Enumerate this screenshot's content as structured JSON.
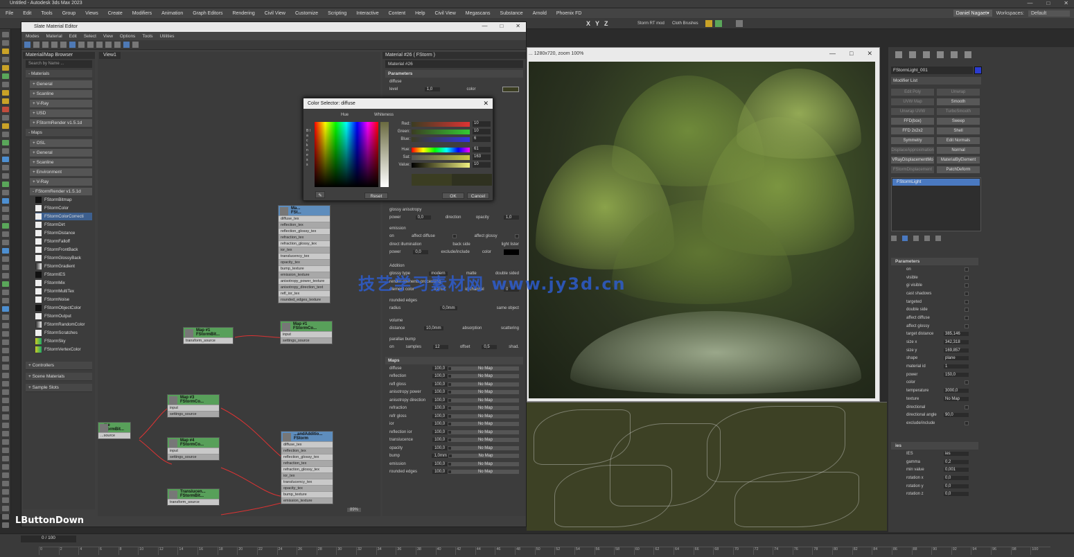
{
  "app": {
    "title": "Untitled - Autodesk 3ds Max 2023",
    "menu": [
      "File",
      "Edit",
      "Tools",
      "Group",
      "Views",
      "Create",
      "Modifiers",
      "Animation",
      "Graph Editors",
      "Rendering",
      "Civil View",
      "Customize",
      "Scripting",
      "Interactive",
      "Content",
      "Help",
      "Civil View",
      "Megascans",
      "Substance",
      "Arnold",
      "Phoenix FD"
    ],
    "user": "Daniel Nagaet▾",
    "workspaces_label": "Workspaces:",
    "workspace": "Default",
    "toolbar_labels": [
      "Storm RT mod",
      "Cloth Brushes"
    ],
    "axes": [
      "X",
      "Y",
      "Z"
    ]
  },
  "sme": {
    "title": "Slate Material Editor",
    "menu": [
      "Modes",
      "Material",
      "Edit",
      "Select",
      "View",
      "Options",
      "Tools",
      "Utilities"
    ],
    "browser": {
      "title": "Material/Map Browser",
      "search": "Search by Name ...",
      "materials_header": "- Materials",
      "materials": [
        "+ General",
        "+ Scanline",
        "+ V-Ray",
        "+ USD",
        "+ FStormRender v1.5.1d"
      ],
      "maps_header": "- Maps",
      "maps": [
        "+ OSL",
        "+ General",
        "+ Scanline",
        "+ Environment",
        "+ V-Ray"
      ],
      "fstorm_header": "- FStormRender v1.5.1d",
      "fstorm_items": [
        "FStormBitmap",
        "FStormColor",
        "FStormColorCorrecti",
        "FStormDirt",
        "FStormDistance",
        "FStormFalloff",
        "FStormFrontBack",
        "FStormGlossyBack",
        "FStormGradient",
        "FStormIES",
        "FStormMix",
        "FStormMultiTex",
        "FStormNoise",
        "FStormObjectColor",
        "FStormOutput",
        "FStormRandomColor",
        "FStormScratches",
        "FStormSky",
        "FStormVertexColor"
      ],
      "extra": [
        "+ Controllers",
        "+ Scene Materials",
        "+ Sample Slots"
      ]
    },
    "view": {
      "tab": "View1",
      "nodes": [
        {
          "title": "Ma...",
          "sub": "FSt...",
          "rows": [
            "diffuse_tex",
            "reflection_tex",
            "reflection_glossy_tex",
            "refraction_tex",
            "refraction_glossy_tex",
            "ior_tex",
            "translucency_tex",
            "opacity_tex",
            "bump_texture",
            "emission_texture",
            "anisotropy_power_texture",
            "anisotropy_direction_text",
            "refl_ior_tex",
            "rounded_edges_texture"
          ]
        },
        {
          "title": "Map #1",
          "sub": "FStormBit...",
          "rows": [
            "transform_source"
          ]
        },
        {
          "title": "Map #1",
          "sub": "FStormCo...",
          "rows": [
            "input",
            "settings_source"
          ]
        },
        {
          "title": "Map #3",
          "sub": "FStormCo...",
          "rows": [
            "input",
            "settings_source"
          ]
        },
        {
          "title": "Map #4",
          "sub": "FStormCo...",
          "rows": [
            "input",
            "settings_source"
          ]
        },
        {
          "title": "...me",
          "sub": "FStormBit...",
          "rows": [
            "...source"
          ]
        },
        {
          "title": "Translucen...",
          "sub": "FStormBit...",
          "rows": [
            "transform_source"
          ]
        },
        {
          "title": "...andAdditio...",
          "sub": "FStorm",
          "rows": [
            "diffuse_tex",
            "reflection_tex",
            "reflection_glossy_tex",
            "refraction_tex",
            "refraction_glossy_tex",
            "ior_tex",
            "translucency_tex",
            "opacity_tex",
            "bump_texture",
            "emission_texture"
          ]
        }
      ],
      "zoom": "89%"
    },
    "params": {
      "header": "Material #26  ( FStorm )",
      "name": "Material #26",
      "section_parameters": "Parameters",
      "diffuse_label": "diffuse",
      "level_label": "level",
      "level_value": "1,0",
      "color_label": "color",
      "glossy_aniso_label": "glossy anisotropy",
      "power_label": "power",
      "power_value": "0,0",
      "direction_label": "direction",
      "opacity_label": "opacity",
      "opacity_value": "1,0",
      "emission_label": "emission",
      "on_label": "on",
      "affect_diffuse": "affect diffuse",
      "affect_glossy": "affect glossy",
      "direct_illum": "direct illumination",
      "back_side": "back side",
      "light_lister": "light lister",
      "emission_power_value": "0,0",
      "exclude_include": "exclude/include",
      "addition_label": "Addition",
      "glossy_type_label": "glossy type",
      "glossy_type_value": "modern",
      "matte_label": "matte",
      "double_sided_label": "double sided",
      "rep_label": "render elements processing",
      "element_color_label": "element color",
      "transit_label": "transit",
      "id_channel_label": "id channel",
      "id_channel_value": "0",
      "rounded_edges_label": "rounded edges",
      "radius_label": "radius",
      "radius_value": "0,0mm",
      "same_object_label": "same object",
      "volume_label": "volume",
      "distance_label": "distance",
      "distance_value": "10,0mm",
      "absorption_label": "absorption",
      "scattering_label": "scattering",
      "parallax_label": "parallax bump",
      "samples_label": "samples",
      "samples_value": "12",
      "offset_label": "offset",
      "offset_value": "0,5",
      "shad_label": "shad.",
      "maps_header": "Maps",
      "maps": [
        {
          "name": "diffuse",
          "value": "100,0",
          "map": "No Map"
        },
        {
          "name": "reflection",
          "value": "100,0",
          "map": "No Map"
        },
        {
          "name": "refl gloss",
          "value": "100,0",
          "map": "No Map"
        },
        {
          "name": "anisotropy power",
          "value": "100,0",
          "map": "No Map"
        },
        {
          "name": "anisotropy direction",
          "value": "100,0",
          "map": "No Map"
        },
        {
          "name": "refraction",
          "value": "100,0",
          "map": "No Map"
        },
        {
          "name": "refr gloss",
          "value": "100,0",
          "map": "No Map"
        },
        {
          "name": "ior",
          "value": "100,0",
          "map": "No Map"
        },
        {
          "name": "reflection ior",
          "value": "100,0",
          "map": "No Map"
        },
        {
          "name": "translucence",
          "value": "100,0",
          "map": "No Map"
        },
        {
          "name": "opacity",
          "value": "100,0",
          "map": "No Map"
        },
        {
          "name": "bump",
          "value": "1,0mm",
          "map": "No Map"
        },
        {
          "name": "emission",
          "value": "100,0",
          "map": "No Map"
        },
        {
          "name": "rounded edges",
          "value": "100,0",
          "map": "No Map"
        }
      ]
    }
  },
  "color_selector": {
    "title": "Color Selector: diffuse",
    "hue_label": "Hue",
    "whiteness_label": "Whiteness",
    "blackness_label": "B l a c k n e s s",
    "channels": [
      {
        "label": "Red:",
        "value": "10"
      },
      {
        "label": "Green:",
        "value": "10"
      },
      {
        "label": "Blue:",
        "value": "6"
      },
      {
        "label": "Hue:",
        "value": "61"
      },
      {
        "label": "Sat:",
        "value": "163"
      },
      {
        "label": "Value:",
        "value": "10"
      }
    ],
    "reset": "Reset",
    "ok": "OK",
    "cancel": "Cancel"
  },
  "render_window": {
    "title": "... 1280x720, zoom 100%"
  },
  "cmd": {
    "object_name": "FStormLight_001",
    "modifier_list": "Modifier List",
    "modifiers": [
      [
        "Edit Poly",
        "Unwrap"
      ],
      [
        "UVW Map",
        "Smooth"
      ],
      [
        "Unwrap UVW",
        "TurboSmooth"
      ],
      [
        "FFD(box)",
        "Sweep"
      ],
      [
        "FFD 2x2x2",
        "Shell"
      ],
      [
        "Symmetry",
        "Edit Normals"
      ],
      [
        "DisplaceApproximation",
        "Normal"
      ],
      [
        "VRayDisplacementMo",
        "MaterialByElement"
      ],
      [
        "FStormDisplacement",
        "PatchDeform"
      ]
    ],
    "stack_item": "FStormLight",
    "params_header": "Parameters",
    "params": [
      {
        "label": "on",
        "value": ""
      },
      {
        "label": "visible",
        "value": ""
      },
      {
        "label": "gi visible",
        "value": ""
      },
      {
        "label": "cast shadows",
        "value": ""
      },
      {
        "label": "targeted",
        "value": ""
      },
      {
        "label": "double side",
        "value": ""
      },
      {
        "label": "affect diffuse",
        "value": ""
      },
      {
        "label": "affect glossy",
        "value": ""
      },
      {
        "label": "target distance",
        "value": "385,146"
      },
      {
        "label": "size x",
        "value": "342,318"
      },
      {
        "label": "size y",
        "value": "169,857"
      },
      {
        "label": "shape",
        "value": "plane"
      },
      {
        "label": "material id",
        "value": "1"
      },
      {
        "label": "power",
        "value": "150,0"
      },
      {
        "label": "color",
        "value": ""
      },
      {
        "label": "temperature",
        "value": "3000,0"
      },
      {
        "label": "texture",
        "value": "No Map"
      },
      {
        "label": "directional",
        "value": ""
      },
      {
        "label": "directional angle",
        "value": "90,0"
      },
      {
        "label": "exclude/include",
        "value": ""
      }
    ],
    "ies_header": "ies",
    "ies": [
      {
        "label": "IES",
        "value": "ies"
      },
      {
        "label": "gamma",
        "value": "0,2"
      },
      {
        "label": "min value",
        "value": "0,001"
      },
      {
        "label": "rotation x",
        "value": "0,0"
      },
      {
        "label": "rotation y",
        "value": "0,0"
      },
      {
        "label": "rotation z",
        "value": "0,0"
      }
    ]
  },
  "timeline": {
    "frame_counter": "0 / 100",
    "ticks": [
      "0",
      "2",
      "4",
      "6",
      "8",
      "10",
      "12",
      "14",
      "16",
      "18",
      "20",
      "22",
      "24",
      "26",
      "28",
      "30",
      "32",
      "34",
      "36",
      "38",
      "40",
      "42",
      "44",
      "46",
      "48",
      "50",
      "52",
      "54",
      "56",
      "58",
      "60",
      "62",
      "64",
      "66",
      "68",
      "70",
      "72",
      "74",
      "76",
      "78",
      "80",
      "82",
      "84",
      "86",
      "88",
      "90",
      "92",
      "94",
      "96",
      "98",
      "100"
    ]
  },
  "overlay": {
    "lbutton": "LButtonDown",
    "watermark": "技艺学习素材网  www.jy3d.cn"
  }
}
